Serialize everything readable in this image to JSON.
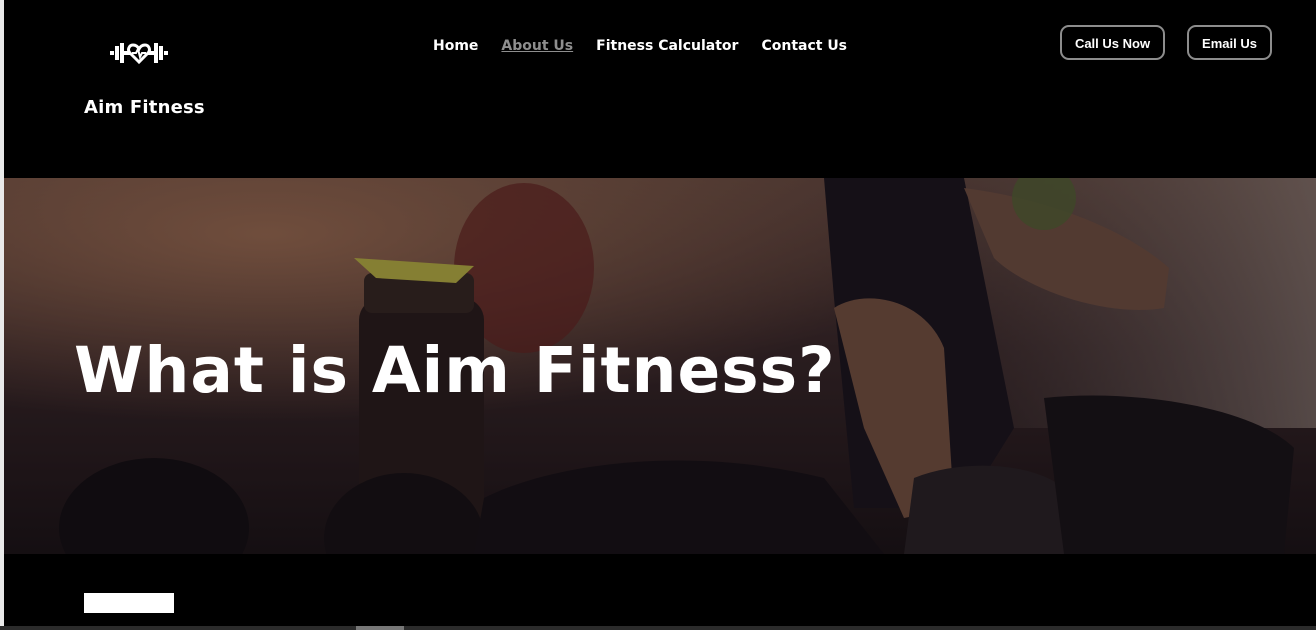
{
  "header": {
    "brand_name": "Aim Fitness",
    "logo_icon": "dumbbell-heart-icon"
  },
  "nav": {
    "items": [
      {
        "label": "Home",
        "active": false
      },
      {
        "label": "About Us",
        "active": true
      },
      {
        "label": "Fitness Calculator",
        "active": false
      },
      {
        "label": "Contact Us",
        "active": false
      }
    ]
  },
  "actions": {
    "call_label": "Call Us Now",
    "email_label": "Email Us"
  },
  "hero": {
    "title": "What is Aim Fitness?"
  },
  "colors": {
    "background": "#000000",
    "text": "#ffffff",
    "nav_active": "#8e8e8e",
    "button_border": "#8d8d8d"
  }
}
